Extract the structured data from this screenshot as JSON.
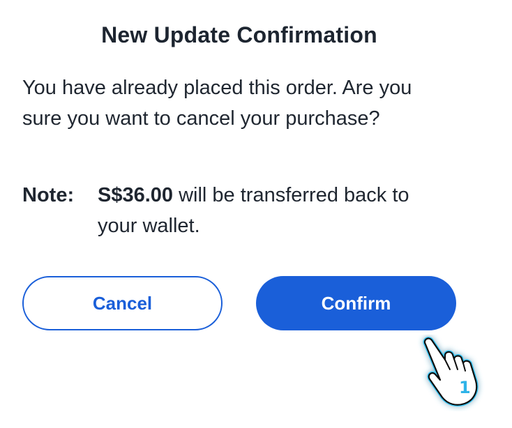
{
  "dialog": {
    "title": "New Update Confirmation",
    "message": "You have already placed this order. Are you sure you want to cancel your purchase?",
    "note": {
      "label": "Note:",
      "amount": "S$36.00",
      "text": " will be transferred back to your wallet."
    },
    "buttons": {
      "cancel_label": "Cancel",
      "confirm_label": "Confirm"
    }
  },
  "cursor": {
    "icon": "hand-pointer-icon",
    "badge": "1"
  },
  "colors": {
    "primary": "#1a5fd9",
    "text": "#1f2630",
    "cursor_glow": "#38c6f4"
  }
}
